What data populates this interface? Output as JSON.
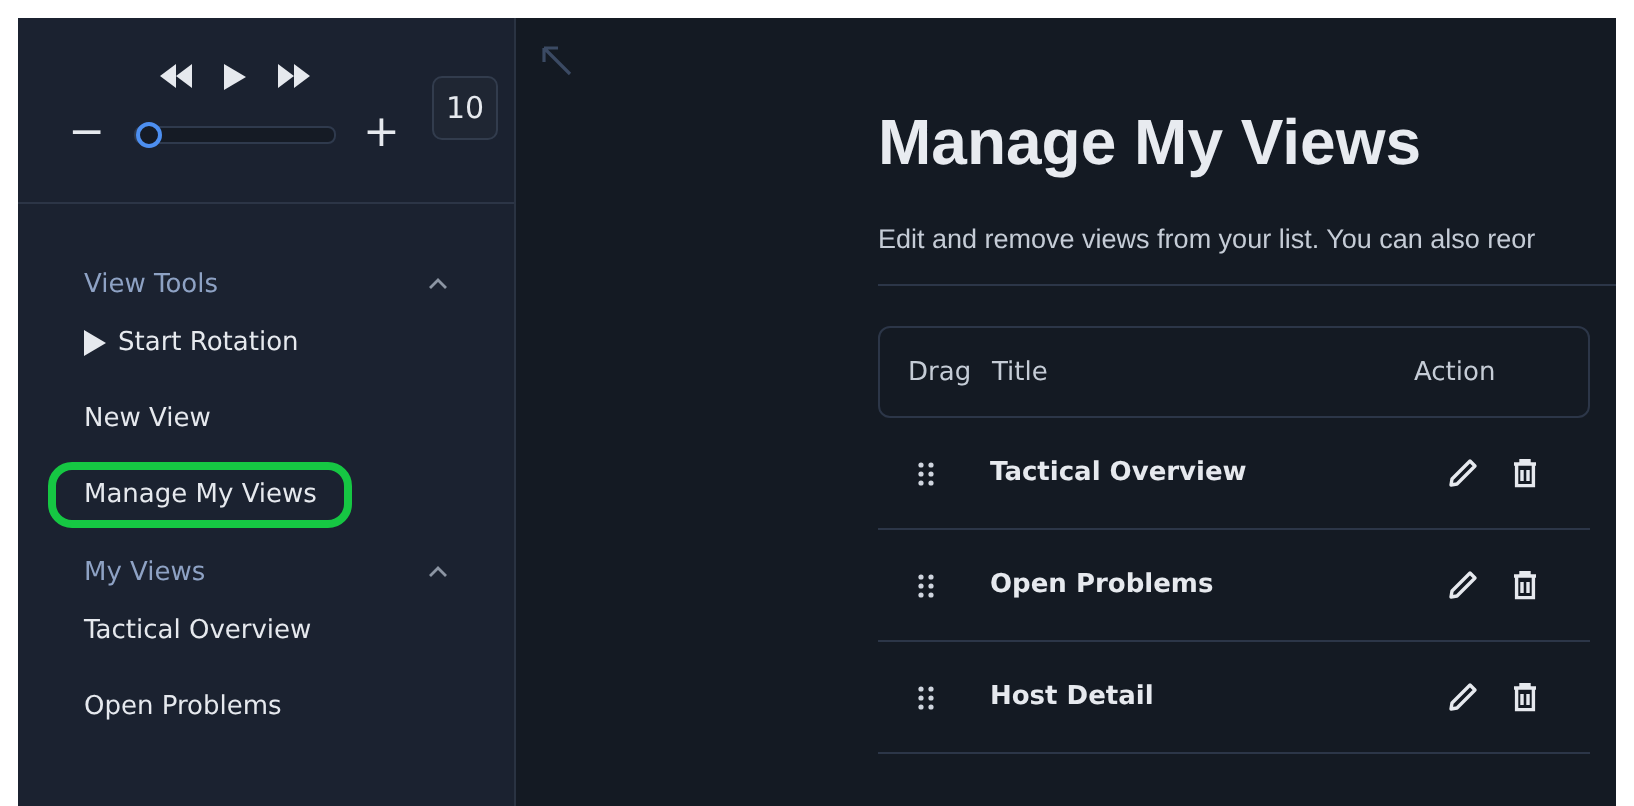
{
  "player": {
    "count": "10",
    "zoom": {
      "minus": "−",
      "plus": "+",
      "level": 0.0
    }
  },
  "sidebar": {
    "sections": [
      {
        "title": "View Tools",
        "expanded": true,
        "items": [
          {
            "label": "Start Rotation",
            "kind": "play",
            "highlighted": false
          },
          {
            "label": "New View",
            "kind": "link",
            "highlighted": false
          },
          {
            "label": "Manage My Views",
            "kind": "link",
            "highlighted": true
          }
        ]
      },
      {
        "title": "My Views",
        "expanded": true,
        "items": [
          {
            "label": "Tactical Overview",
            "kind": "link",
            "highlighted": false
          },
          {
            "label": "Open Problems",
            "kind": "link",
            "highlighted": false
          }
        ]
      }
    ]
  },
  "main": {
    "title": "Manage My Views",
    "description": "Edit and remove views from your list. You can also reor",
    "table": {
      "columns": [
        "Drag",
        "Title",
        "Action"
      ],
      "rows": [
        {
          "title": "Tactical Overview"
        },
        {
          "title": "Open Problems"
        },
        {
          "title": "Host Detail"
        }
      ]
    }
  }
}
